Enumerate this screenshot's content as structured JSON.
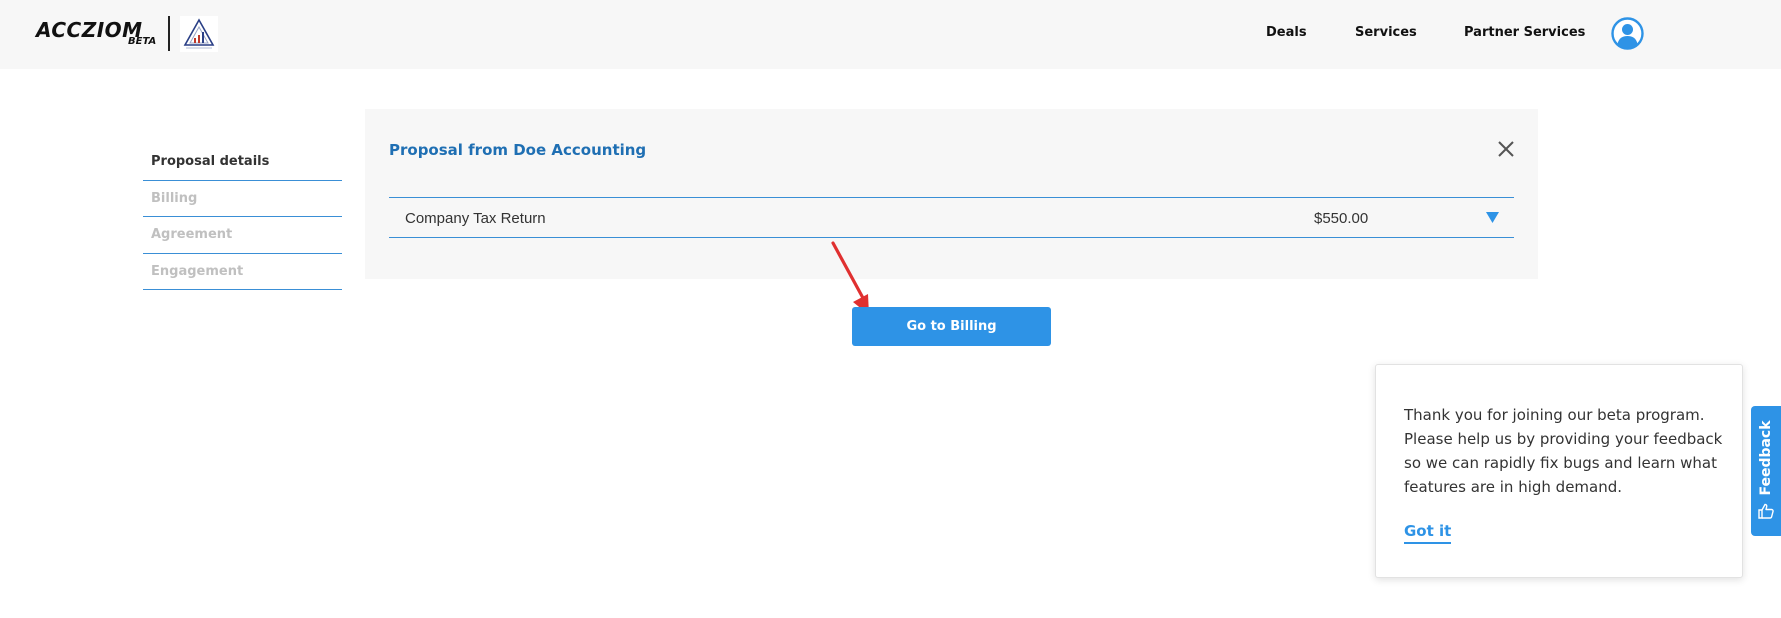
{
  "header": {
    "brand": "ACCZIOM",
    "brand_tag": "BETA",
    "nav": {
      "deals": "Deals",
      "services": "Services",
      "partner_services": "Partner Services"
    },
    "icons": {
      "avatar": "user-avatar-icon",
      "partner_logo": "partner-logo"
    }
  },
  "sidebar": {
    "items": [
      {
        "label": "Proposal details",
        "state": "active"
      },
      {
        "label": "Billing",
        "state": "inactive"
      },
      {
        "label": "Agreement",
        "state": "inactive"
      },
      {
        "label": "Engagement",
        "state": "inactive"
      }
    ]
  },
  "proposal": {
    "title": "Proposal from Doe Accounting",
    "line_item": {
      "name": "Company Tax Return",
      "price": "$550.00"
    },
    "icons": {
      "close": "close-icon",
      "expand": "triangle-down-icon"
    }
  },
  "actions": {
    "go_to_billing": "Go to Billing"
  },
  "beta_popup": {
    "message": "Thank you for joining our beta program. Please help us by providing your feedback so we can rapidly fix bugs and learn what features are in high demand.",
    "dismiss": "Got it"
  },
  "feedback_tab": {
    "label": "Feedback",
    "icon": "thumbs-up-icon"
  },
  "colors": {
    "accent": "#2e93e6",
    "title_blue": "#1f6fb3",
    "divider_blue": "#3a8fd6",
    "annotation_arrow": "#e03030",
    "header_bg": "#f7f7f7"
  }
}
